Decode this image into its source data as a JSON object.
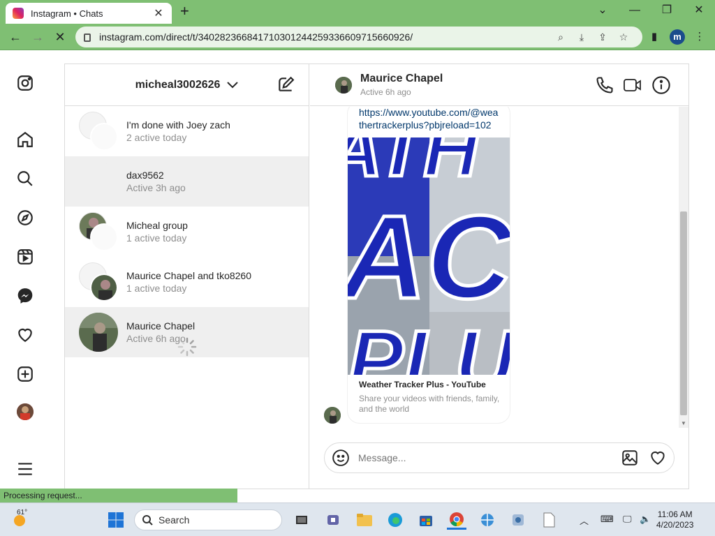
{
  "browser": {
    "tab_title": "Instagram • Chats",
    "url": "instagram.com/direct/t/340282366841710301244259336609715660926/",
    "profile_initial": "m",
    "status_text": "Processing request...",
    "accent_color": "#7fbf73"
  },
  "inbox": {
    "username": "micheal3002626",
    "conversations": [
      {
        "name": "I'm done with Joey zach",
        "status": "2 active today"
      },
      {
        "name": "dax9562",
        "status": "Active 3h ago"
      },
      {
        "name": "Micheal group",
        "status": "1 active today"
      },
      {
        "name": "Maurice Chapel and tko8260",
        "status": "1 active today"
      },
      {
        "name": "Maurice Chapel",
        "status": "Active 6h ago"
      }
    ]
  },
  "chat": {
    "name": "Maurice Chapel",
    "status": "Active 6h ago",
    "link_text": "https://www.youtube.com/@weathertrackerplus?pbjreload=102",
    "preview_title": "Weather Tracker Plus - YouTube",
    "preview_desc": "Share your videos with friends, family, and the world",
    "composer_placeholder": "Message..."
  },
  "taskbar": {
    "weather_temp": "61°",
    "search_label": "Search",
    "time": "11:06 AM",
    "date": "4/20/2023"
  }
}
